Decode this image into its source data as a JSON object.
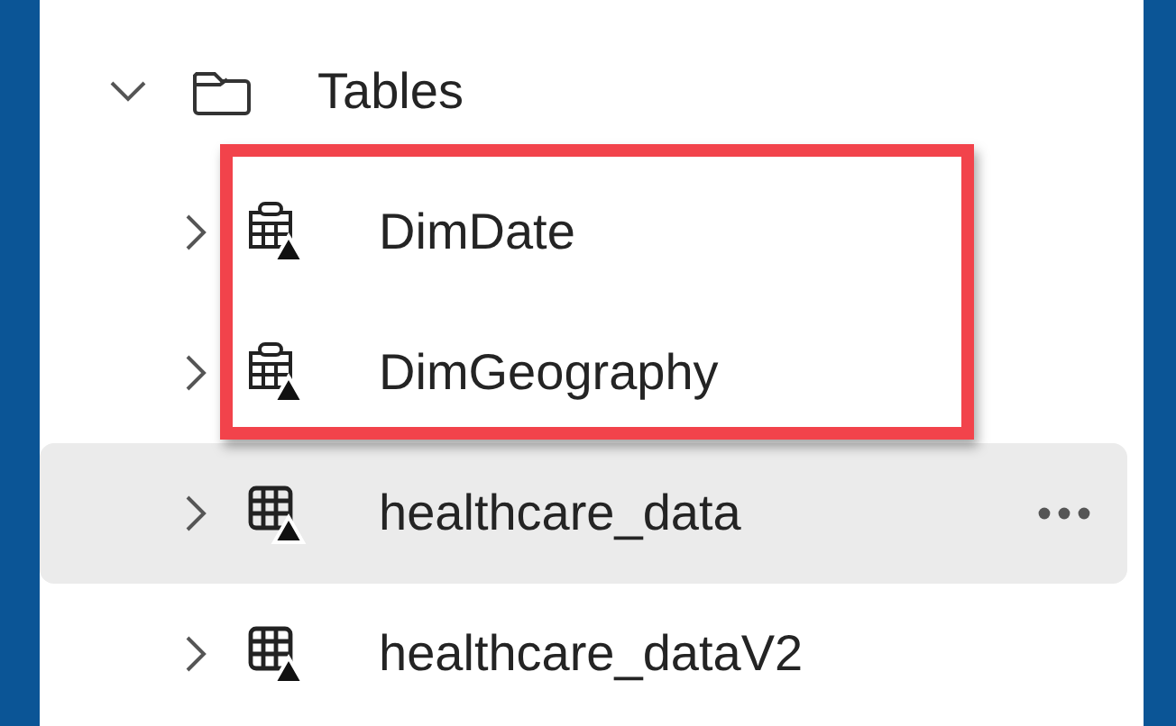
{
  "tree": [
    {
      "label": "Tables",
      "kind": "folder",
      "expanded": true,
      "children": [
        {
          "label": "DimDate",
          "kind": "linked-table",
          "expanded": false,
          "outlined": true,
          "highlighted": false
        },
        {
          "label": "DimGeography",
          "kind": "linked-table",
          "expanded": false,
          "outlined": true,
          "highlighted": false
        },
        {
          "label": "healthcare_data",
          "kind": "table",
          "expanded": false,
          "outlined": false,
          "highlighted": true
        },
        {
          "label": "healthcare_dataV2",
          "kind": "table",
          "expanded": false,
          "outlined": false,
          "highlighted": false
        }
      ]
    }
  ]
}
